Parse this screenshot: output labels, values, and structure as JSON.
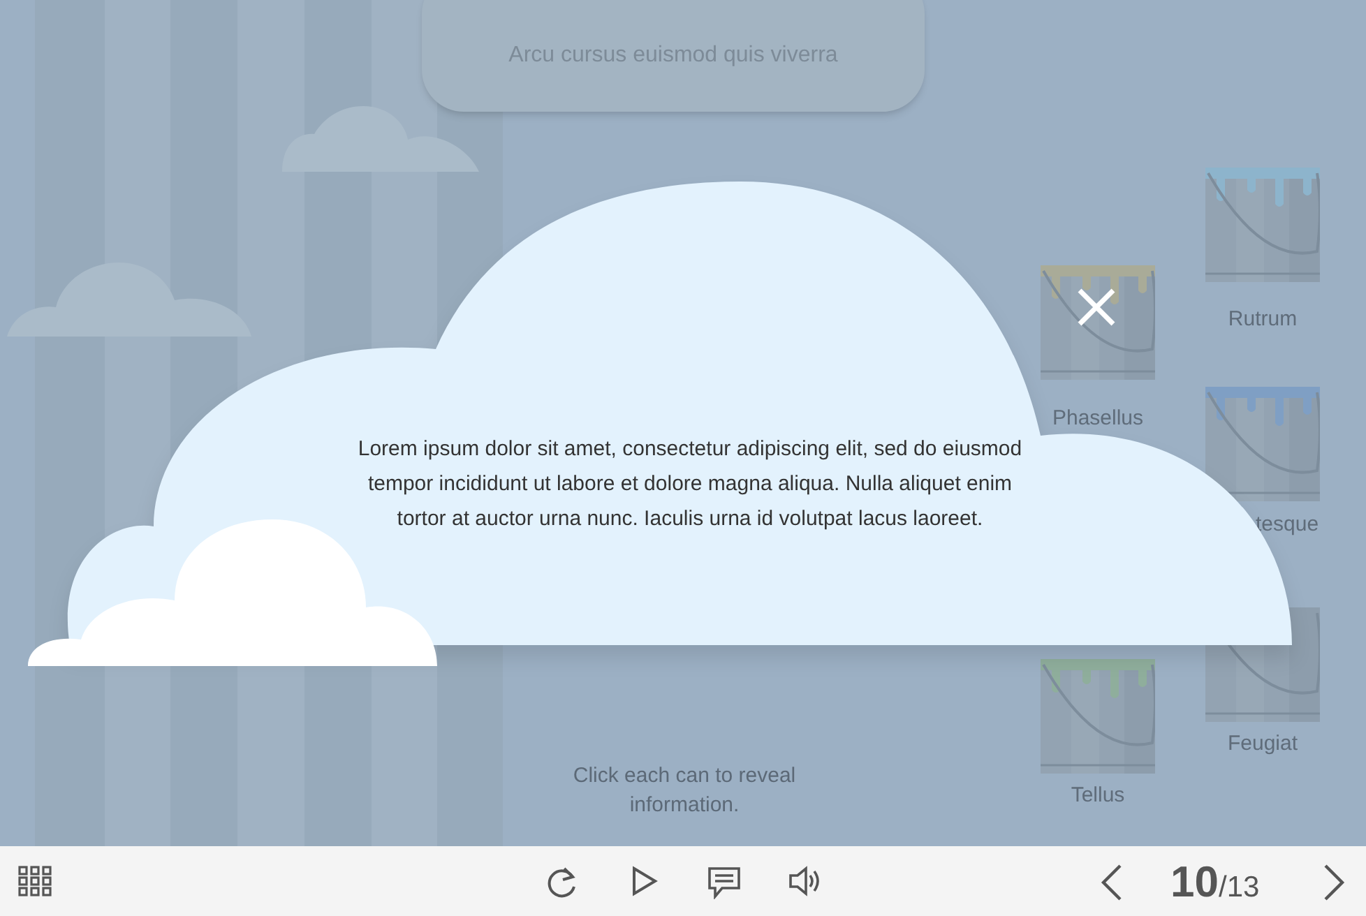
{
  "heading": "Arcu cursus euismod quis viverra",
  "cans": [
    {
      "label": "Phasellus",
      "color": "#a9ab98"
    },
    {
      "label": "Rutrum",
      "color": "#8db4cc"
    },
    {
      "label": "tesque",
      "color": "#7f9fc4"
    },
    {
      "label": "Feugiat"
    },
    {
      "label": "Tellus",
      "color": "#8fae9c"
    }
  ],
  "hint": "Click each can to reveal information.",
  "popup": {
    "text": "Lorem ipsum dolor sit amet, consectetur adipiscing elit, sed do eiusmod tempor incididunt ut labore et dolore magna aliqua. Nulla aliquet enim tortor at auctor urna nunc. Iaculis urna id volutpat lacus laoreet."
  },
  "toolbar": {
    "page": "10",
    "total": "/13"
  }
}
